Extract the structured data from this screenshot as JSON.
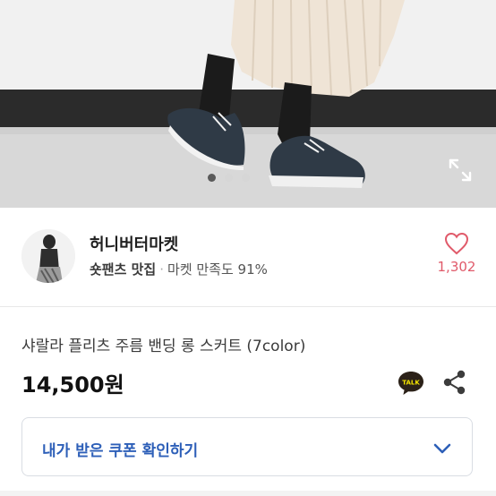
{
  "hero": {
    "slide_count": 3,
    "active_slide": 1,
    "expand_icon": "expand-icon"
  },
  "shop": {
    "name": "허니버터마켓",
    "tag": "숏팬츠 맛집",
    "separator": "·",
    "satisfaction": "마켓 만족도 91%",
    "like_count": "1,302",
    "like_icon": "heart-outline-icon",
    "accent_color": "#e05a6a"
  },
  "product": {
    "title": "샤랄라 플리츠 주름 밴딩 롱 스커트 (7color)",
    "price": "14,500원",
    "talk_label": "TALK",
    "share_icon": "share-icon"
  },
  "coupon": {
    "label": "내가 받은 쿠폰 확인하기",
    "chevron_icon": "chevron-down-icon",
    "accent_color": "#2d5fb8"
  }
}
